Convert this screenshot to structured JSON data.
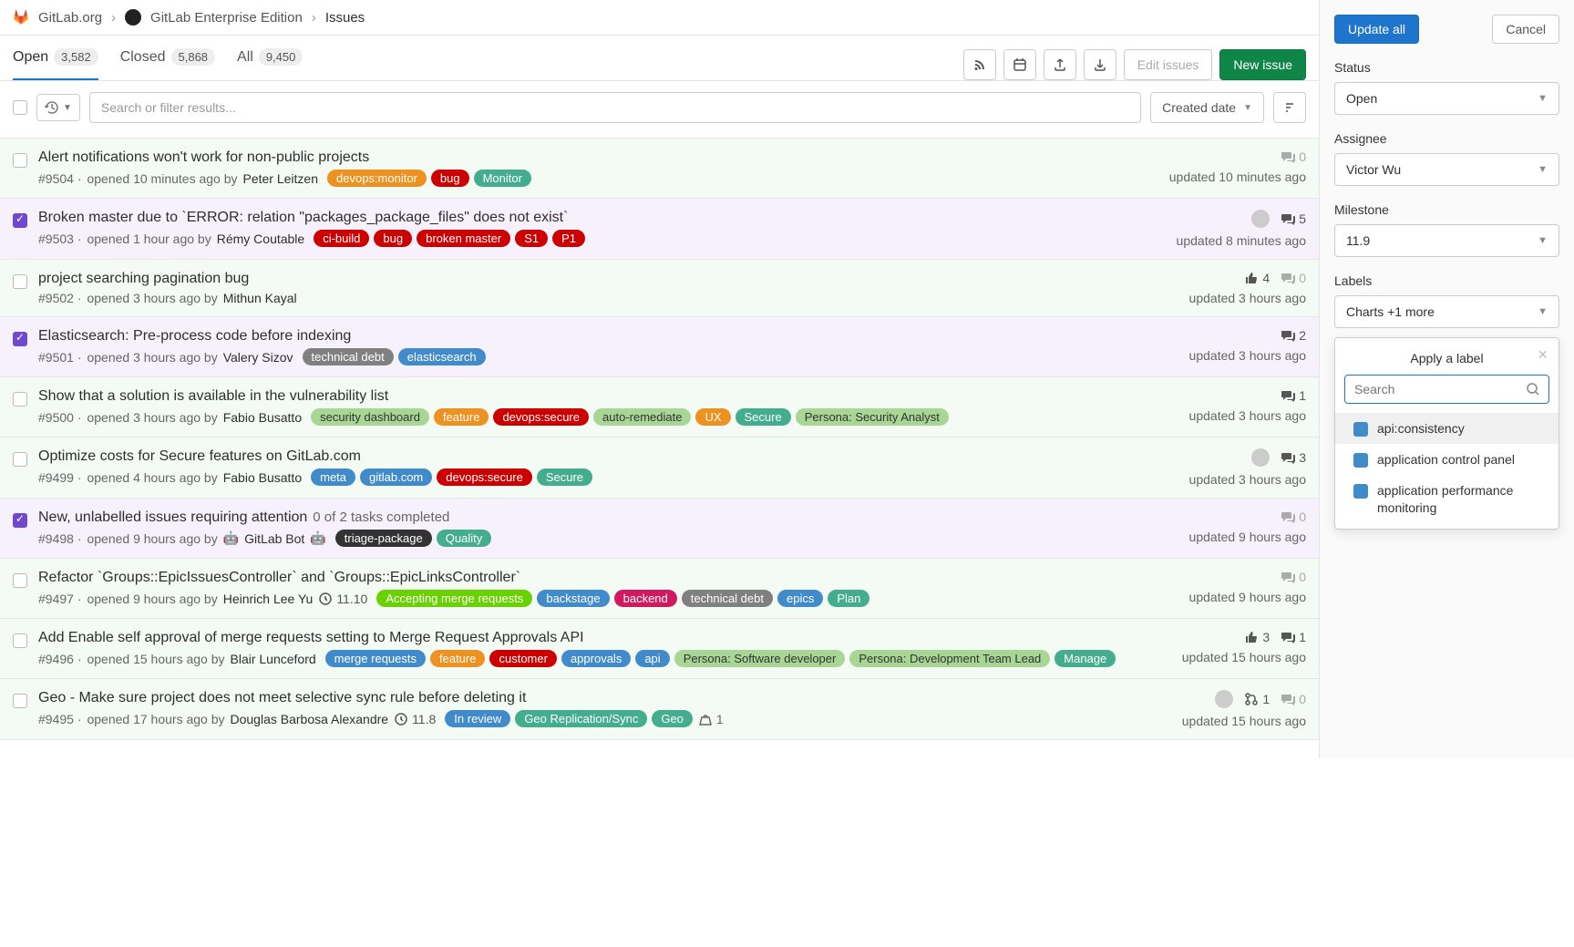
{
  "breadcrumb": {
    "org": "GitLab.org",
    "project": "GitLab Enterprise Edition",
    "page": "Issues"
  },
  "tabs": {
    "open": {
      "label": "Open",
      "count": "3,582"
    },
    "closed": {
      "label": "Closed",
      "count": "5,868"
    },
    "all": {
      "label": "All",
      "count": "9,450"
    }
  },
  "toolbar": {
    "edit": "Edit issues",
    "new": "New issue"
  },
  "filters": {
    "search_placeholder": "Search or filter results...",
    "sort": "Created date"
  },
  "label_colors": {
    "devops:monitor": "#ed9121",
    "bug": "#cc0000",
    "Monitor": "#44ad8e",
    "ci-build": "#cc0000",
    "broken master": "#cc0000",
    "S1": "#cc0000",
    "P1": "#cc0000",
    "technical debt": "#808080",
    "elasticsearch": "#428bca",
    "security dashboard": "#a8d695",
    "feature": "#ed9121",
    "devops:secure": "#cc0000",
    "auto-remediate": "#a8d695",
    "UX": "#ed9121",
    "Secure": "#44ad8e",
    "Persona: Security Analyst": "#a8d695",
    "meta": "#428bca",
    "gitlab.com": "#428bca",
    "triage-package": "#333333",
    "Quality": "#44ad8e",
    "Accepting merge requests": "#69d100",
    "backstage": "#428bca",
    "backend": "#d1195f",
    "epics": "#428bca",
    "Plan": "#44ad8e",
    "merge requests": "#428bca",
    "customer": "#cc0000",
    "approvals": "#428bca",
    "api": "#428bca",
    "Persona: Software developer": "#a8d695",
    "Persona: Development Team Lead": "#a8d695",
    "Manage": "#44ad8e",
    "In review": "#428bca",
    "Geo Replication/Sync": "#44ad8e",
    "Geo": "#44ad8e"
  },
  "issues": [
    {
      "title": "Alert notifications won't work for non-public projects",
      "id": "#9504",
      "opened": "opened 10 minutes ago by",
      "author": "Peter Leitzen",
      "labels": [
        "devops:monitor",
        "bug",
        "Monitor"
      ],
      "comments": 0,
      "comments_muted": true,
      "updated": "updated 10 minutes ago",
      "selected": false
    },
    {
      "title": "Broken master due to `ERROR: relation \"packages_package_files\" does not exist`",
      "id": "#9503",
      "opened": "opened 1 hour ago by",
      "author": "Rémy Coutable",
      "labels": [
        "ci-build",
        "bug",
        "broken master",
        "S1",
        "P1"
      ],
      "comments": 5,
      "assignee": true,
      "updated": "updated 8 minutes ago",
      "selected": true
    },
    {
      "title": "project searching pagination bug",
      "id": "#9502",
      "opened": "opened 3 hours ago by",
      "author": "Mithun Kayal",
      "labels": [],
      "upvotes": 4,
      "comments": 0,
      "comments_muted": true,
      "updated": "updated 3 hours ago",
      "selected": false
    },
    {
      "title": "Elasticsearch: Pre-process code before indexing",
      "id": "#9501",
      "opened": "opened 3 hours ago by",
      "author": "Valery Sizov",
      "labels": [
        "technical debt",
        "elasticsearch"
      ],
      "comments": 2,
      "updated": "updated 3 hours ago",
      "selected": true
    },
    {
      "title": "Show that a solution is available in the vulnerability list",
      "id": "#9500",
      "opened": "opened 3 hours ago by",
      "author": "Fabio Busatto",
      "labels": [
        "security dashboard",
        "feature",
        "devops:secure",
        "auto-remediate",
        "UX",
        "Secure",
        "Persona: Security Analyst"
      ],
      "comments": 1,
      "updated": "updated 3 hours ago",
      "selected": false
    },
    {
      "title": "Optimize costs for Secure features on GitLab.com",
      "id": "#9499",
      "opened": "opened 4 hours ago by",
      "author": "Fabio Busatto",
      "labels": [
        "meta",
        "gitlab.com",
        "devops:secure",
        "Secure"
      ],
      "comments": 3,
      "assignee": true,
      "updated": "updated 3 hours ago",
      "selected": false
    },
    {
      "title": "New, unlabelled issues requiring attention",
      "tasks": "0 of 2 tasks completed",
      "id": "#9498",
      "opened": "opened 9 hours ago by",
      "author": "GitLab Bot",
      "author_icon": "🤖",
      "labels": [
        "triage-package",
        "Quality"
      ],
      "comments": 0,
      "comments_muted": true,
      "updated": "updated 9 hours ago",
      "selected": true
    },
    {
      "title": "Refactor `Groups::EpicIssuesController` and `Groups::EpicLinksController`",
      "id": "#9497",
      "opened": "opened 9 hours ago by",
      "author": "Heinrich Lee Yu",
      "milestone": "11.10",
      "labels": [
        "Accepting merge requests",
        "backstage",
        "backend",
        "technical debt",
        "epics",
        "Plan"
      ],
      "comments": 0,
      "comments_muted": true,
      "updated": "updated 9 hours ago",
      "selected": false
    },
    {
      "title": "Add Enable self approval of merge requests setting to Merge Request Approvals API",
      "id": "#9496",
      "opened": "opened 15 hours ago by",
      "author": "Blair Lunceford",
      "labels": [
        "merge requests",
        "feature",
        "customer",
        "approvals",
        "api",
        "Persona: Software developer",
        "Persona: Development Team Lead",
        "Manage"
      ],
      "upvotes": 3,
      "comments": 1,
      "updated": "updated 15 hours ago",
      "selected": false
    },
    {
      "title": "Geo - Make sure project does not meet selective sync rule before deleting it",
      "id": "#9495",
      "opened": "opened 17 hours ago by",
      "author": "Douglas Barbosa Alexandre",
      "milestone": "11.8",
      "labels": [
        "In review",
        "Geo Replication/Sync",
        "Geo"
      ],
      "mrs": 1,
      "comments": 0,
      "comments_muted": true,
      "assignee": true,
      "confidential": 1,
      "updated": "updated 15 hours ago",
      "selected": false
    }
  ],
  "sidebar": {
    "update": "Update all",
    "cancel": "Cancel",
    "status_label": "Status",
    "status_value": "Open",
    "assignee_label": "Assignee",
    "assignee_value": "Victor Wu",
    "milestone_label": "Milestone",
    "milestone_value": "11.9",
    "labels_label": "Labels",
    "labels_value": "Charts +1 more",
    "dropdown": {
      "title": "Apply a label",
      "search_placeholder": "Search",
      "options": [
        {
          "name": "api:consistency",
          "color": "#428bca",
          "highlight": true
        },
        {
          "name": "application control panel",
          "color": "#428bca"
        },
        {
          "name": "application performance monitoring",
          "color": "#428bca"
        }
      ]
    }
  }
}
